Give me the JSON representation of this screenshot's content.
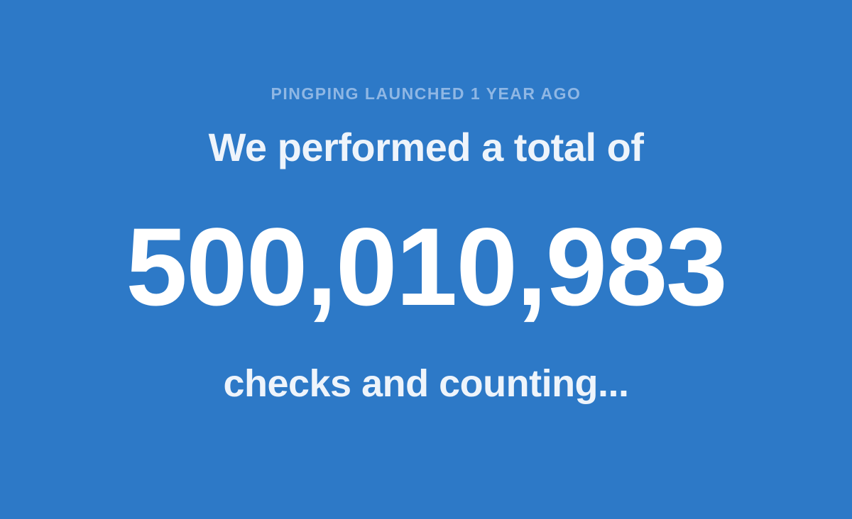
{
  "announcement": {
    "eyebrow": "PINGPING LAUNCHED 1 YEAR AGO",
    "headline": "We performed a total of",
    "count": "500,010,983",
    "subline": "checks and counting..."
  },
  "colors": {
    "background": "#2d79c7",
    "eyebrow_text": "#8fb7e4",
    "primary_text": "#ffffff"
  }
}
